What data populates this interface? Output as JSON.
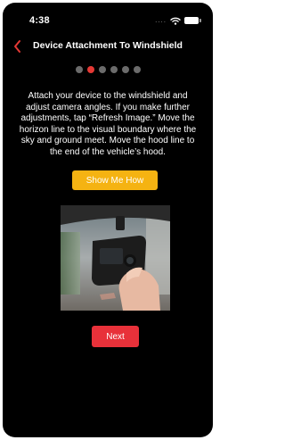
{
  "status_bar": {
    "time": "4:38",
    "signal_glyph": "....",
    "icons": [
      "wifi-icon",
      "battery-icon"
    ]
  },
  "nav": {
    "back_icon": "chevron-left-icon",
    "title": "Device Attachment To Windshield",
    "accent_color": "#e53935"
  },
  "pager": {
    "total_steps": 6,
    "current_step": 2
  },
  "instructions": "Attach your device to the windshield and adjust camera angles. If you make further adjustments, tap “Refresh Image.” Move the horizon line to the visual boundary where the sky and ground meet. Move the hood line to the end of the vehicle’s hood.",
  "show_me_how_button": {
    "label": "Show Me How",
    "color": "#f5b312"
  },
  "device_photo": {
    "icon": "dashcam-photo"
  },
  "next_button": {
    "label": "Next",
    "color": "#e8313a"
  }
}
